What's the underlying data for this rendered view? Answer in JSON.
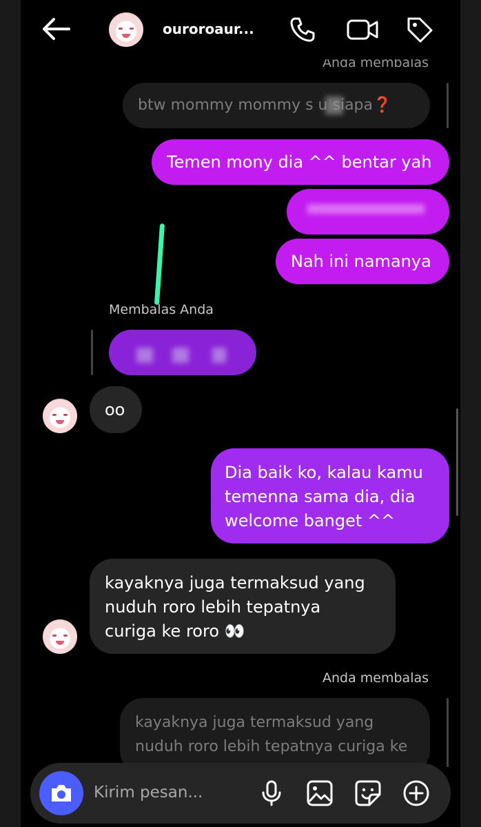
{
  "header": {
    "username": "ouroroaur...",
    "back_icon": "arrow-left-icon",
    "call_icon": "phone-icon",
    "video_icon": "video-camera-icon",
    "tag_icon": "tag-icon"
  },
  "messages": {
    "top_reply_label": "Anda membalas",
    "quoted_1": "btw mommy mommy s   u siapa",
    "out_1": "Temen mony dia ^^ bentar yah",
    "out_3": "Nah ini namanya",
    "reply_label_2": "Membalas Anda",
    "in_oo": "oo",
    "out_4_line1": "Dia baik ko, kalau kamu",
    "out_4_line2": "temenna sama dia, dia",
    "out_4_line3": "welcome banget ^^",
    "in_2_line1": "kayaknya juga termaksud yang",
    "in_2_line2": "nuduh roro lebih tepatnya",
    "in_2_line3": "curiga ke roro 👀",
    "reply_label_3": "Anda membalas",
    "quoted_2_line1": "kayaknya juga termaksud yang",
    "quoted_2_line2": "nuduh roro lebih tepatnya curiga ke"
  },
  "composer": {
    "placeholder": "Kirim pesan...",
    "camera_icon": "camera-icon",
    "mic_icon": "microphone-icon",
    "gallery_icon": "image-icon",
    "sticker_icon": "sticker-icon",
    "plus_icon": "plus-circle-icon"
  },
  "colors": {
    "outgoing_bubble": "#c21cf0",
    "outgoing_bubble_alt": "#a02cf0",
    "incoming_bubble": "#262626",
    "camera_button": "#4c5dff",
    "annotation_stroke": "#3df5a8"
  }
}
